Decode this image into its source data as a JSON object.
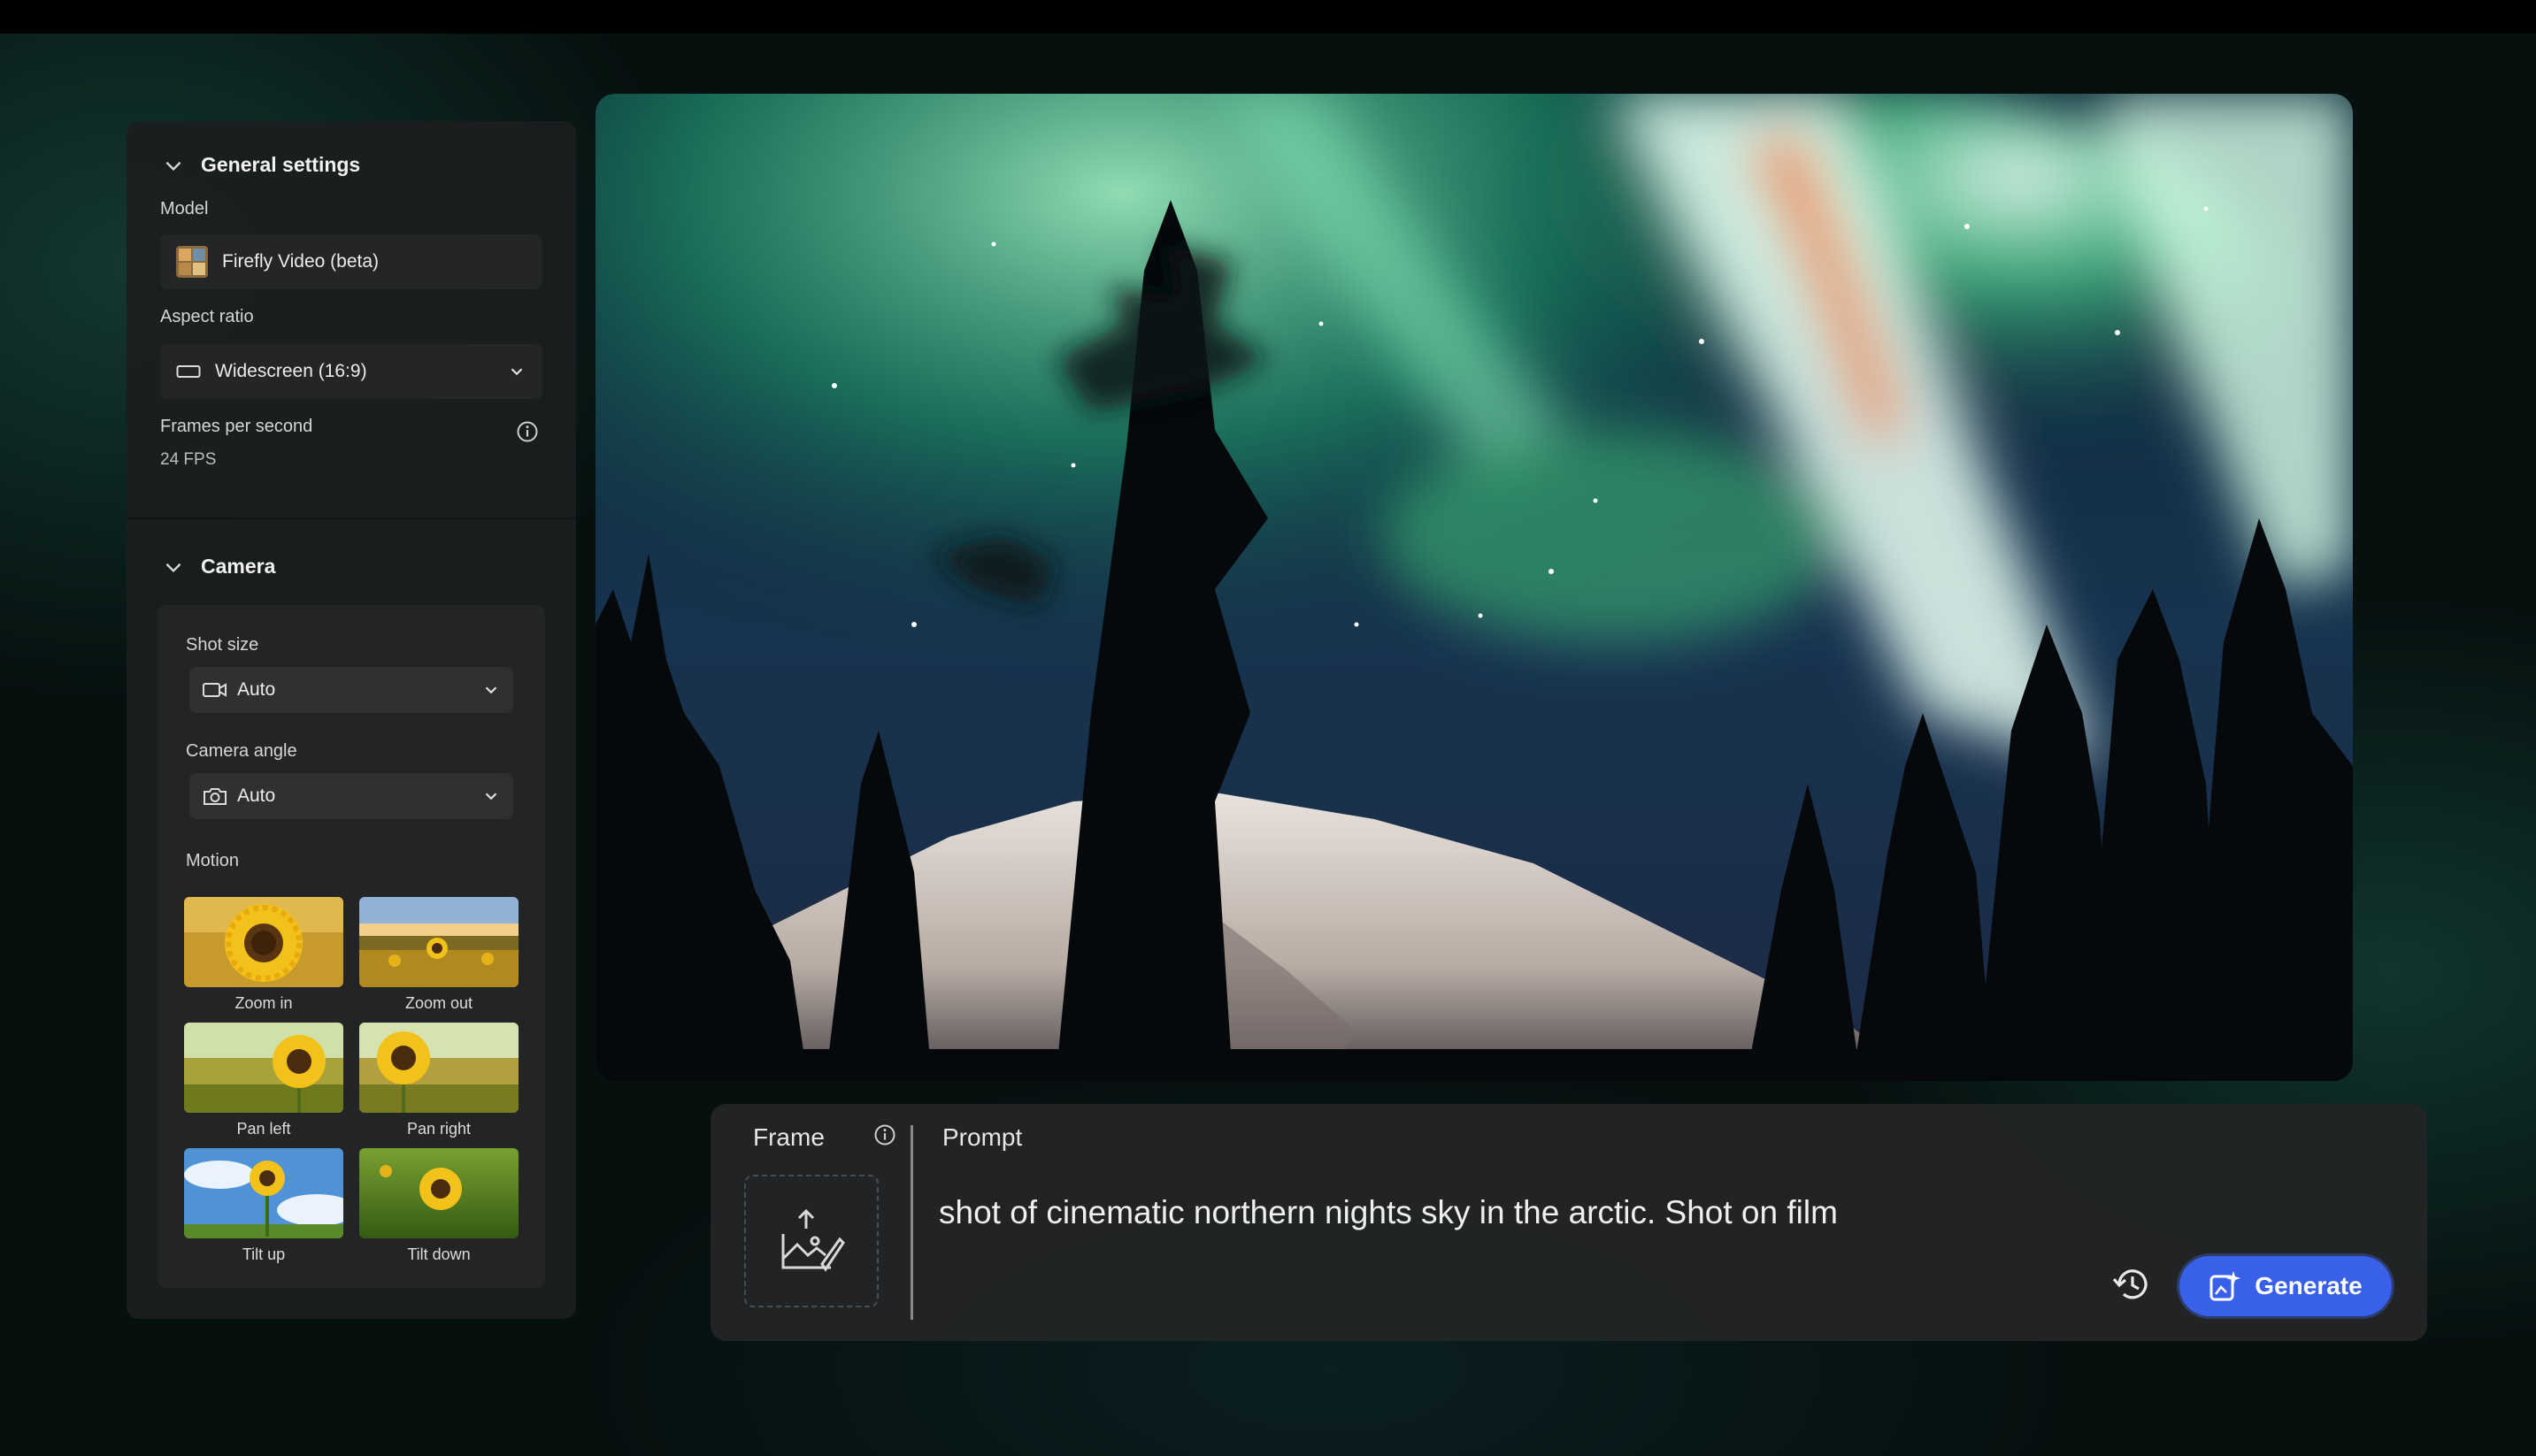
{
  "sidebar": {
    "general": {
      "title": "General settings",
      "model_label": "Model",
      "model_value": "Firefly Video (beta)",
      "aspect_label": "Aspect ratio",
      "aspect_value": "Widescreen (16:9)",
      "fps_label": "Frames per second",
      "fps_value": "24 FPS"
    },
    "camera": {
      "title": "Camera",
      "shot_size_label": "Shot size",
      "shot_size_value": "Auto",
      "camera_angle_label": "Camera angle",
      "camera_angle_value": "Auto",
      "motion_label": "Motion",
      "motions": [
        {
          "label": "Zoom in"
        },
        {
          "label": "Zoom out"
        },
        {
          "label": "Pan left"
        },
        {
          "label": "Pan right"
        },
        {
          "label": "Tilt up"
        },
        {
          "label": "Tilt down"
        }
      ]
    }
  },
  "prompt_panel": {
    "frame_label": "Frame",
    "prompt_label": "Prompt",
    "prompt_text": "shot of cinematic northern nights sky in the arctic. Shot on film",
    "generate_label": "Generate"
  },
  "colors": {
    "accent": "#3860e8",
    "panel": "#1c1e1f",
    "field": "#232526"
  }
}
